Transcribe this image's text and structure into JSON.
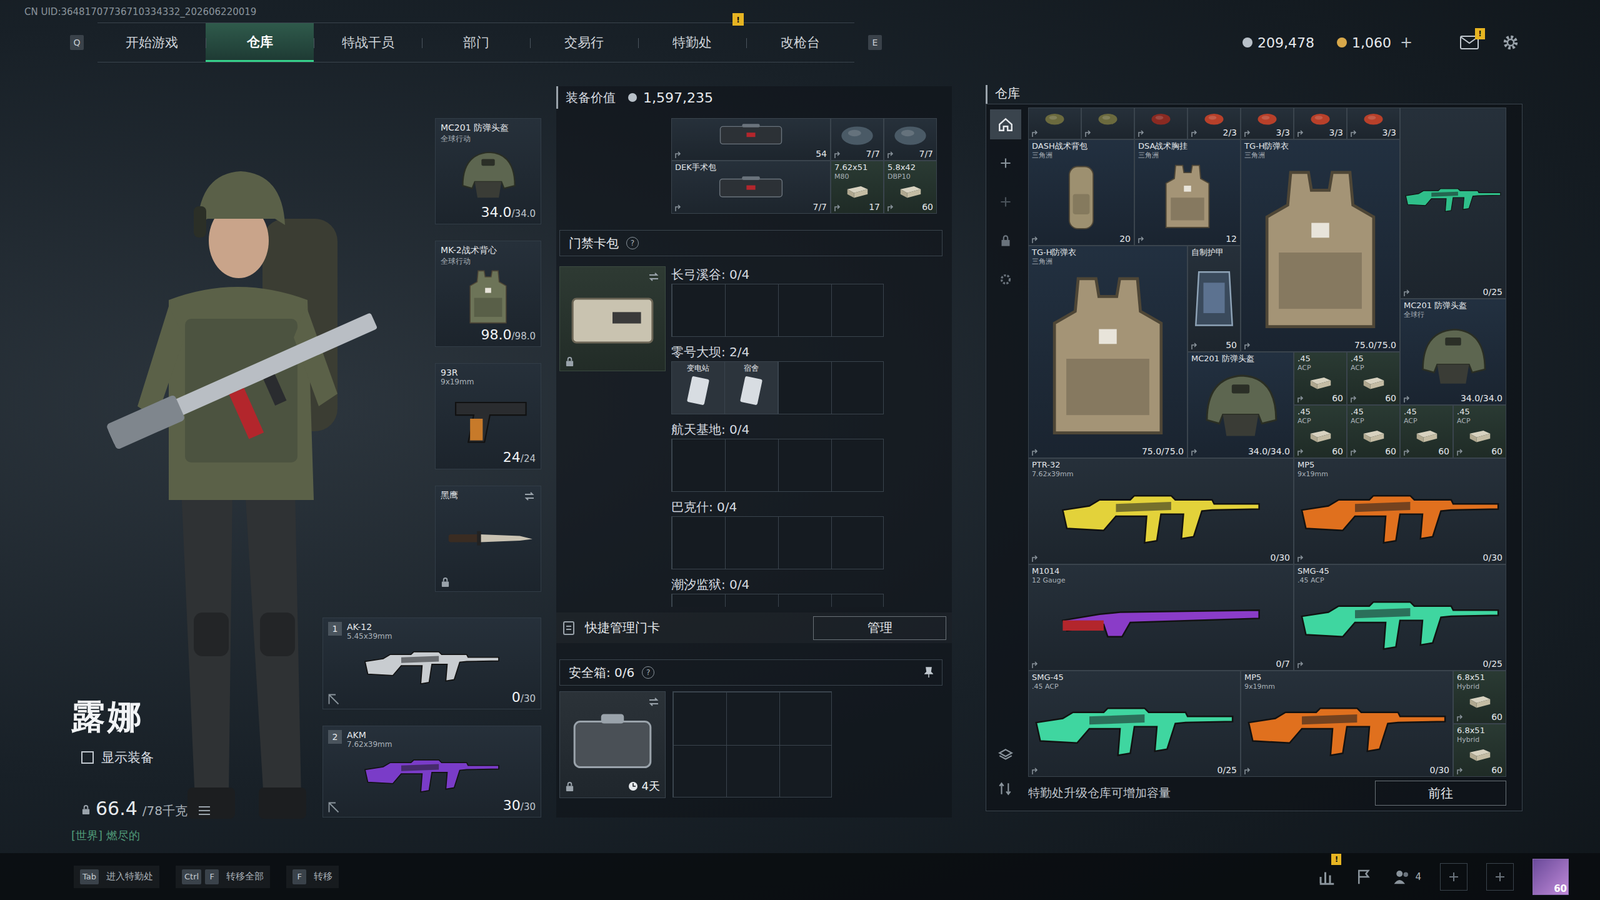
{
  "uid": "CN UID:36481707736710334332_202606220019",
  "nav": {
    "left_key": "Q",
    "right_key": "E",
    "tabs": [
      {
        "label": "开始游戏",
        "selected": false
      },
      {
        "label": "仓库",
        "selected": true
      },
      {
        "label": "特战干员",
        "selected": false
      },
      {
        "label": "部门",
        "selected": false
      },
      {
        "label": "交易行",
        "selected": false
      },
      {
        "label": "特勤处",
        "selected": false,
        "badge": "!"
      },
      {
        "label": "改枪台",
        "selected": false
      }
    ]
  },
  "currency": [
    {
      "value": "209,478",
      "color": "#b8c0c8"
    },
    {
      "value": "1,060",
      "plus": "+",
      "color": "#d8a84a"
    }
  ],
  "mail_badge": "!",
  "operator": {
    "name": "露娜",
    "show_gear_label": "显示装备",
    "show_gear": false,
    "weight": "66.4",
    "weight_max": "/78千克",
    "chat": "[世界] 燃尽的"
  },
  "gear": [
    {
      "kind": "helmet",
      "name": "MC201 防弹头盔",
      "sub": "全球行动",
      "value": "34.0",
      "max": "/34.0",
      "color": "#5d6650",
      "locked": false
    },
    {
      "kind": "vest",
      "name": "MK-2战术背心",
      "sub": "全球行动",
      "value": "98.0",
      "max": "/98.0",
      "color": "#6d7458",
      "locked": false
    },
    {
      "kind": "pistol",
      "name": "93R",
      "sub": "9x19mm",
      "value": "24",
      "max": "/24",
      "color": "#c77a2a",
      "locked": false
    },
    {
      "kind": "knife",
      "name": "黑鹰",
      "color": "#c9c2b2",
      "locked": true
    }
  ],
  "weapons": [
    {
      "slot": "1",
      "name": "AK-12",
      "sub": "5.45x39mm",
      "ammo": "0",
      "ammo_max": "/30",
      "color": "#c8ccd0"
    },
    {
      "slot": "2",
      "name": "AKM",
      "sub": "7.62x39mm",
      "ammo": "30",
      "ammo_max": "/30",
      "color": "#7a3cc8"
    }
  ],
  "loadout": {
    "value_label": "装备价值",
    "value": "1,597,235",
    "backpack": [
      {
        "kind": "case",
        "count": "54"
      },
      {
        "kind": "misc",
        "color": "#4a5a66",
        "count": "7/7"
      },
      {
        "kind": "misc",
        "color": "#4a5a66",
        "count": "7/7"
      },
      {
        "kind": "case",
        "name": "DEK手术包",
        "count": "7/7"
      },
      {
        "kind": "ammo",
        "name": "7.62x51",
        "sub": "M80",
        "count": "17"
      },
      {
        "kind": "ammo",
        "name": "5.8x42",
        "sub": "DBP10",
        "count": "60"
      }
    ],
    "keycard": {
      "title": "门禁卡包",
      "help": "?",
      "maps": [
        {
          "label": "长弓溪谷: 0/4",
          "cards": []
        },
        {
          "label": "零号大坝: 2/4",
          "cards": [
            {
              "name": "变电站"
            },
            {
              "name": "宿舍"
            }
          ]
        },
        {
          "label": "航天基地: 0/4",
          "cards": []
        },
        {
          "label": "巴克什: 0/4",
          "cards": []
        },
        {
          "label": "潮汐监狱: 0/4",
          "cards": []
        }
      ]
    },
    "quick": {
      "label": "快捷管理门卡",
      "button": "管理"
    },
    "safebox": {
      "title": "安全箱: 0/6",
      "help": "?",
      "timer": "4天"
    }
  },
  "warehouse": {
    "title": "仓库",
    "sidebar_tabs": [
      {
        "selected": true
      },
      {
        "selected": false
      },
      {
        "selected": false
      },
      {
        "selected": false
      },
      {
        "selected": false
      }
    ],
    "items": [
      {
        "kind": "misc",
        "color": "#6b6a3e"
      },
      {
        "kind": "misc",
        "color": "#6b6a3e"
      },
      {
        "kind": "misc",
        "color": "#8a2a22"
      },
      {
        "kind": "misc",
        "color": "#b8402a",
        "count": "2/3"
      },
      {
        "kind": "misc",
        "color": "#b8402a",
        "count": "3/3"
      },
      {
        "kind": "misc",
        "color": "#b8402a",
        "count": "3/3"
      },
      {
        "kind": "misc",
        "color": "#b8402a",
        "count": "3/3"
      },
      {
        "kind": "rifle",
        "color": "#2fbf8a",
        "count": "0/25"
      },
      {
        "kind": "bag",
        "name": "DASH战术背包",
        "sub": "三角洲",
        "count": "20"
      },
      {
        "kind": "chest",
        "name": "DSA战术胸挂",
        "sub": "三角洲",
        "count": "12"
      },
      {
        "kind": "vest",
        "name": "TG-H防弹衣",
        "sub": "三角洲",
        "count": "75.0/75.0",
        "color": "#a49476"
      },
      {
        "kind": "vest",
        "name": "TG-H防弹衣",
        "sub": "三角洲",
        "count": "75.0/75.0",
        "color": "#a49476"
      },
      {
        "kind": "plate",
        "name": "自制护甲",
        "count": "50"
      },
      {
        "kind": "helmet",
        "name": "MC201 防弹头盔",
        "sub": "全球行",
        "count": "34.0/34.0",
        "color": "#5d6650"
      },
      {
        "kind": "helmet",
        "name": "MC201 防弹头盔",
        "count": "34.0/34.0",
        "color": "#5d6650"
      },
      {
        "kind": "ammo",
        "name": ".45",
        "sub": "ACP",
        "count": "60"
      },
      {
        "kind": "ammo",
        "name": ".45",
        "sub": "ACP",
        "count": "60"
      },
      {
        "kind": "ammo",
        "name": ".45",
        "sub": "ACP",
        "count": "60"
      },
      {
        "kind": "ammo",
        "name": ".45",
        "sub": "ACP",
        "count": "60"
      },
      {
        "kind": "ammo",
        "name": ".45",
        "sub": "ACP",
        "count": "60"
      },
      {
        "kind": "ammo",
        "name": ".45",
        "sub": "ACP",
        "count": "60"
      },
      {
        "kind": "rifle",
        "name": "PTR-32",
        "sub": "7.62x39mm",
        "color": "#e3d23a",
        "count": "0/30"
      },
      {
        "kind": "smg",
        "name": "MP5",
        "sub": "9x19mm",
        "color": "#e0701e",
        "count": "0/30"
      },
      {
        "kind": "shotgun",
        "name": "M1014",
        "sub": "12 Gauge",
        "color": "#8a3cc8",
        "count": "0/7"
      },
      {
        "kind": "smg",
        "name": "SMG-45",
        "sub": ".45 ACP",
        "color": "#3fd6a0",
        "count": "0/25"
      },
      {
        "kind": "smg",
        "name": "SMG-45",
        "sub": ".45 ACP",
        "color": "#3fd6a0",
        "count": "0/25"
      },
      {
        "kind": "smg",
        "name": "MP5",
        "sub": "9x19mm",
        "color": "#e0701e",
        "count": "0/30"
      },
      {
        "kind": "ammo",
        "name": "6.8x51",
        "sub": "Hybrid",
        "count": "60"
      },
      {
        "kind": "ammo",
        "name": "6.8x51",
        "sub": "Hybrid",
        "count": "60"
      }
    ],
    "footer": "特勤处升级仓库可增加容量",
    "button": "前往"
  },
  "hotkeys": [
    {
      "keys": [
        "Tab"
      ],
      "label": "进入特勤处"
    },
    {
      "keys": [
        "Ctrl",
        "F"
      ],
      "label": "转移全部"
    },
    {
      "keys": [
        "F"
      ],
      "label": "转移"
    }
  ],
  "social": {
    "stats_badge": "!",
    "friends": "4",
    "level": "60"
  }
}
